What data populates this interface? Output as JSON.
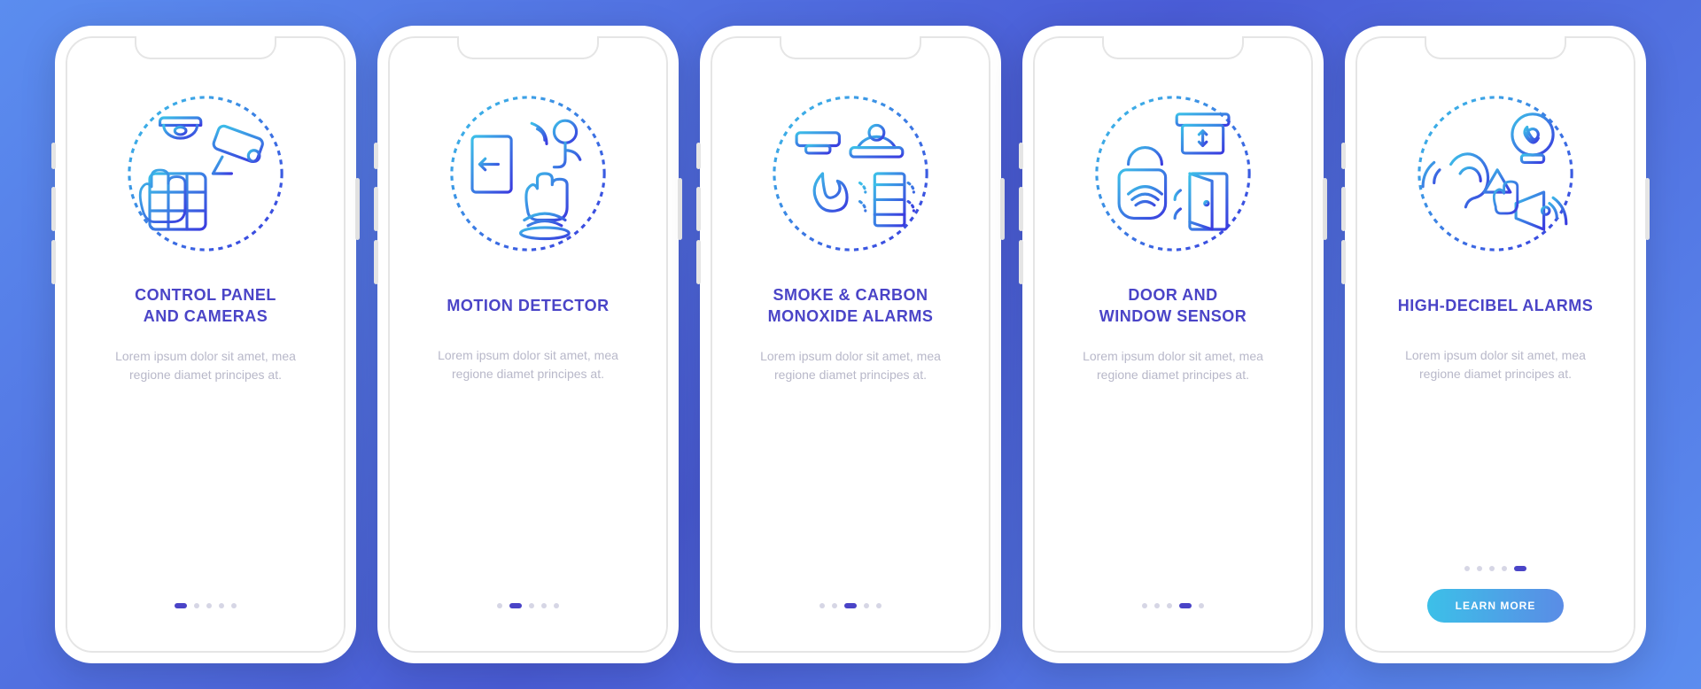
{
  "colors": {
    "accent": "#4a44c7",
    "iconGradFrom": "#3cc0e8",
    "iconGradTo": "#3a3adf"
  },
  "screens": [
    {
      "title": "CONTROL PANEL\nAND CAMERAS",
      "desc": "Lorem ipsum dolor sit amet, mea regione diamet principes at.",
      "icon": "control-panel-cameras",
      "activeDot": 0,
      "showButton": false
    },
    {
      "title": "MOTION DETECTOR",
      "desc": "Lorem ipsum dolor sit amet, mea regione diamet principes at.",
      "icon": "motion-detector",
      "activeDot": 1,
      "showButton": false
    },
    {
      "title": "SMOKE & CARBON\nMONOXIDE ALARMS",
      "desc": "Lorem ipsum dolor sit amet, mea regione diamet principes at.",
      "icon": "smoke-co-alarms",
      "activeDot": 2,
      "showButton": false
    },
    {
      "title": "DOOR AND\nWINDOW SENSOR",
      "desc": "Lorem ipsum dolor sit amet, mea regione diamet principes at.",
      "icon": "door-window-sensor",
      "activeDot": 3,
      "showButton": false
    },
    {
      "title": "HIGH-DECIBEL ALARMS",
      "desc": "Lorem ipsum dolor sit amet, mea regione diamet principes at.",
      "icon": "high-decibel-alarms",
      "activeDot": 4,
      "showButton": true
    }
  ],
  "dotCount": 5,
  "ctaLabel": "LEARN MORE"
}
